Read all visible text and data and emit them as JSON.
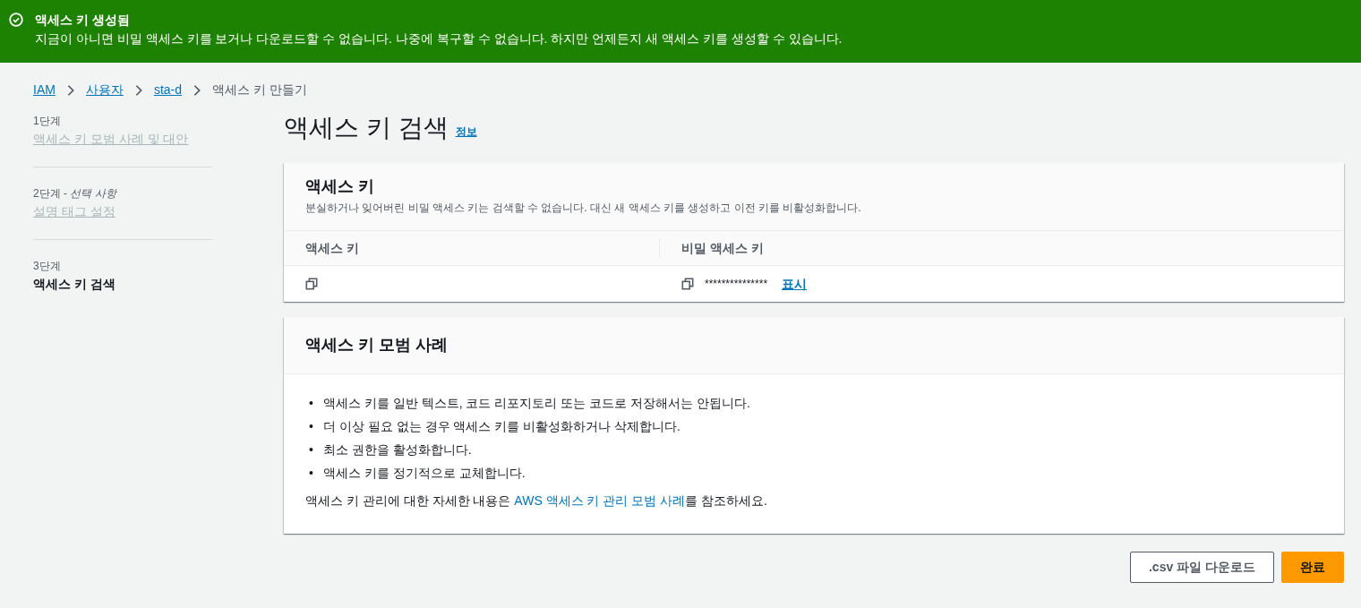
{
  "flash": {
    "title": "액세스 키 생성됨",
    "message": "지금이 아니면 비밀 액세스 키를 보거나 다운로드할 수 없습니다. 나중에 복구할 수 없습니다. 하지만 언제든지 새 액세스 키를 생성할 수 있습니다."
  },
  "breadcrumbs": [
    {
      "label": "IAM",
      "kind": "link"
    },
    {
      "label": "사용자",
      "kind": "link"
    },
    {
      "label": "sta-d",
      "kind": "link"
    },
    {
      "label": "액세스 키 만들기",
      "kind": "current"
    }
  ],
  "steps": [
    {
      "label": "1단계",
      "title": "액세스 키 모범 사례 및 대안",
      "selected": false
    },
    {
      "label": "2단계 - *선택 사항*",
      "title": "설명 태그 설정",
      "selected": false
    },
    {
      "label": "3단계",
      "title": "액세스 키 검색",
      "selected": true
    }
  ],
  "page_title": "액세스 키 검색",
  "info_link": "정보",
  "keys_panel": {
    "title": "액세스 키",
    "description": "분실하거나 잊어버린 비밀 액세스 키는 검색할 수 없습니다. 대신 새 액세스 키를 생성하고 이전 키를 비활성화합니다.",
    "columns": [
      "액세스 키",
      "비밀 액세스 키"
    ],
    "secret_value": "***************",
    "show_link": "표시"
  },
  "practices_panel": {
    "title": "액세스 키 모범 사례",
    "items": [
      {
        "marker": "•",
        "text": "액세스 키를 일반 텍스트, 코드 리포지토리 또는 코드로 저장해서는 안됩니다."
      },
      {
        "marker": "•",
        "text": "더 이상 필요 없는 경우 액세스 키를 비활성화하거나 삭제합니다."
      },
      {
        "marker": "•",
        "text": "최소 권한을 활성화합니다."
      },
      {
        "marker": "•",
        "text": "액세스 키를 정기적으로 교체합니다."
      }
    ],
    "footer_before": "액세스 키 관리에 대한 자세한 내용은 ",
    "footer_link": "AWS 액세스 키 관리 모범 사례",
    "footer_after": "를 참조하세요."
  },
  "buttons": [
    {
      "label": ".csv 파일 다운로드",
      "kind": "secondary"
    },
    {
      "label": "완료",
      "kind": "primary"
    }
  ]
}
